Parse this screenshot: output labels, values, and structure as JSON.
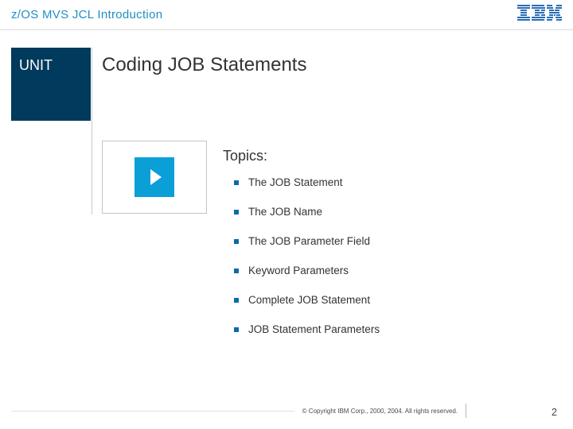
{
  "header": {
    "title": "z/OS MVS JCL Introduction",
    "logo_name": "IBM"
  },
  "unit": {
    "label": "UNIT"
  },
  "main": {
    "title": "Coding JOB Statements"
  },
  "topics": {
    "label": "Topics:",
    "items": [
      "The JOB Statement",
      "The JOB Name",
      "The JOB Parameter Field",
      "Keyword Parameters",
      "Complete JOB Statement",
      "JOB Statement Parameters"
    ]
  },
  "footer": {
    "copyright": "© Copyright IBM Corp., 2000, 2004. All rights reserved.",
    "page": "2"
  }
}
